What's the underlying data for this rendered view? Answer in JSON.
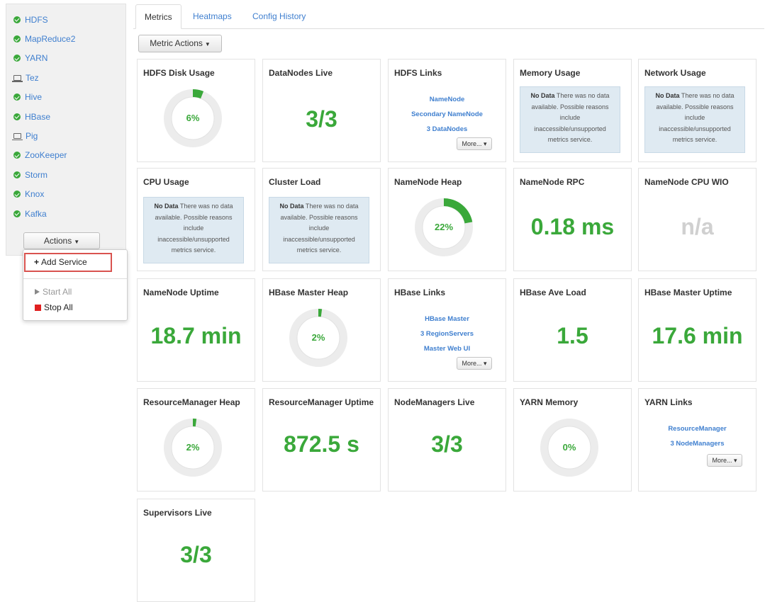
{
  "sidebar": {
    "services": [
      {
        "name": "HDFS",
        "icon": "check-circle-icon"
      },
      {
        "name": "MapReduce2",
        "icon": "check-circle-icon"
      },
      {
        "name": "YARN",
        "icon": "check-circle-icon"
      },
      {
        "name": "Tez",
        "icon": "laptop-icon"
      },
      {
        "name": "Hive",
        "icon": "check-circle-icon"
      },
      {
        "name": "HBase",
        "icon": "check-circle-icon"
      },
      {
        "name": "Pig",
        "icon": "laptop-icon"
      },
      {
        "name": "ZooKeeper",
        "icon": "check-circle-icon"
      },
      {
        "name": "Storm",
        "icon": "check-circle-icon"
      },
      {
        "name": "Knox",
        "icon": "check-circle-icon"
      },
      {
        "name": "Kafka",
        "icon": "check-circle-icon"
      }
    ],
    "actions_label": "Actions",
    "menu": {
      "add_service": "Add Service",
      "start_all": "Start All",
      "stop_all": "Stop All"
    }
  },
  "tabs": [
    "Metrics",
    "Heatmaps",
    "Config History"
  ],
  "metric_actions_label": "Metric Actions",
  "colors": {
    "accent_green": "#3aa83a",
    "link_blue": "#3f7fcf",
    "highlight_red": "#d9534f"
  },
  "no_data": {
    "bold": "No Data",
    "text": "There was no data available. Possible reasons include inaccessible/unsupported metrics service."
  },
  "more_label": "More...",
  "widgets": {
    "hdfs_disk": {
      "title": "HDFS Disk Usage",
      "label": "6%",
      "fraction": 0.06
    },
    "datanodes_live": {
      "title": "DataNodes Live",
      "value": "3/3"
    },
    "hdfs_links": {
      "title": "HDFS Links",
      "links": [
        "NameNode",
        "Secondary NameNode",
        "3 DataNodes"
      ]
    },
    "memory_usage": {
      "title": "Memory Usage"
    },
    "network_usage": {
      "title": "Network Usage"
    },
    "cpu_usage": {
      "title": "CPU Usage"
    },
    "cluster_load": {
      "title": "Cluster Load"
    },
    "namenode_heap": {
      "title": "NameNode Heap",
      "label": "22%",
      "fraction": 0.22
    },
    "namenode_rpc": {
      "title": "NameNode RPC",
      "value": "0.18 ms"
    },
    "namenode_cpu_wio": {
      "title": "NameNode CPU WIO",
      "value": "n/a"
    },
    "namenode_uptime": {
      "title": "NameNode Uptime",
      "value": "18.7 min"
    },
    "hbase_master_heap": {
      "title": "HBase Master Heap",
      "label": "2%",
      "fraction": 0.02
    },
    "hbase_links": {
      "title": "HBase Links",
      "links": [
        "HBase Master",
        "3 RegionServers",
        "Master Web UI"
      ]
    },
    "hbase_ave_load": {
      "title": "HBase Ave Load",
      "value": "1.5"
    },
    "hbase_master_uptime": {
      "title": "HBase Master Uptime",
      "value": "17.6 min"
    },
    "rm_heap": {
      "title": "ResourceManager Heap",
      "label": "2%",
      "fraction": 0.02
    },
    "rm_uptime": {
      "title": "ResourceManager Uptime",
      "value": "872.5 s"
    },
    "nodemanagers_live": {
      "title": "NodeManagers Live",
      "value": "3/3"
    },
    "yarn_memory": {
      "title": "YARN Memory",
      "label": "0%",
      "fraction": 0.0
    },
    "yarn_links": {
      "title": "YARN Links",
      "links": [
        "ResourceManager",
        "3 NodeManagers"
      ]
    },
    "supervisors_live": {
      "title": "Supervisors Live",
      "value": "3/3"
    }
  }
}
